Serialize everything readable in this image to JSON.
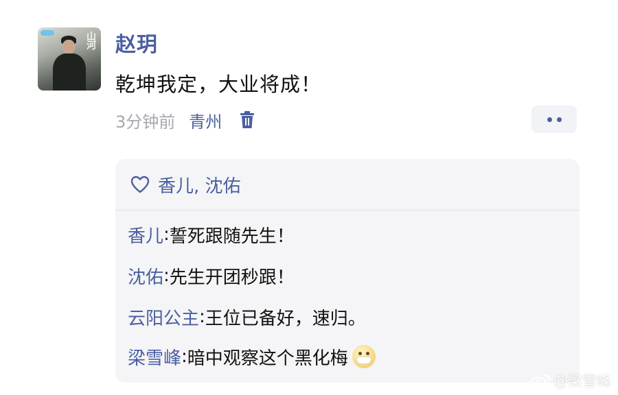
{
  "post": {
    "author": "赵玥",
    "text": "乾坤我定，大业将成！",
    "time": "3分钟前",
    "location": "青州"
  },
  "avatar": {
    "icon": "drama-poster-avatar"
  },
  "actions": {
    "delete_icon": "trash-icon",
    "more_icon": "more-dots-icon"
  },
  "likes": {
    "icon": "heart-outline-icon",
    "names": "香儿, 沈佑"
  },
  "comments": [
    {
      "author": "香儿",
      "text": "誓死跟随先生！"
    },
    {
      "author": "沈佑",
      "text": "先生开团秒跟！"
    },
    {
      "author": "云阳公主",
      "text": "王位已备好，速归。"
    },
    {
      "author": "梁雪峰",
      "text": "暗中观察这个黑化梅",
      "emoji": "face-with-mask-emoji"
    }
  ],
  "watermark": {
    "text": "@梁雪峰"
  },
  "colors": {
    "link_blue": "#4a5fa0",
    "meta_gray": "#a7a7ad",
    "panel_bg": "#f5f5f7",
    "more_bg": "#f2f3f6"
  }
}
